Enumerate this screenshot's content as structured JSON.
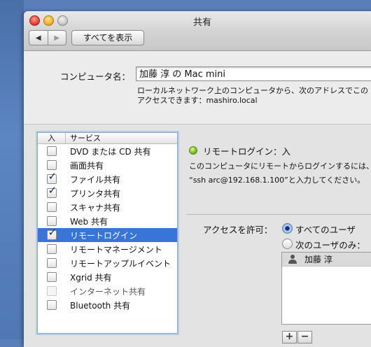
{
  "window": {
    "title": "共有"
  },
  "toolbar": {
    "back_glyph": "◀",
    "forward_glyph": "▶",
    "show_all_label": "すべてを表示"
  },
  "computer_name": {
    "label": "コンピュータ名：",
    "value": "加藤 淳 の Mac mini",
    "note_line1": "ローカルネットワーク上のコンピュータから、次のアドレスでこの",
    "note_line2": "アクセスできます：mashiro.local"
  },
  "services": {
    "header_on": "入",
    "header_service": "サービス",
    "items": [
      {
        "name": "DVD または CD 共有",
        "checked": false
      },
      {
        "name": "画面共有",
        "checked": false
      },
      {
        "name": "ファイル共有",
        "checked": true
      },
      {
        "name": "プリンタ共有",
        "checked": true
      },
      {
        "name": "スキャナ共有",
        "checked": false
      },
      {
        "name": "Web 共有",
        "checked": false
      },
      {
        "name": "リモートログイン",
        "checked": true,
        "selected": true
      },
      {
        "name": "リモートマネージメント",
        "checked": false
      },
      {
        "name": "リモートアップルイベント",
        "checked": false
      },
      {
        "name": "Xgrid 共有",
        "checked": false
      },
      {
        "name": "インターネット共有",
        "checked": false,
        "disabled": true
      },
      {
        "name": "Bluetooth 共有",
        "checked": false
      }
    ]
  },
  "detail": {
    "status": "リモートログイン：入",
    "status_color": "#7cc21d",
    "desc_line1": "このコンピュータにリモートからログインするには、",
    "desc_line2": "“ssh arc@192.168.1.100”と入力してください。",
    "access_label": "アクセスを許可：",
    "radio_all": "すべてのユーザ",
    "radio_only": "次のユーザのみ：",
    "radio_selected": "all",
    "users": [
      "加藤 淳"
    ],
    "add_label": "+",
    "remove_label": "−"
  },
  "colors": {
    "selection": "#3875d7",
    "desktop": "#5a7fb8"
  }
}
